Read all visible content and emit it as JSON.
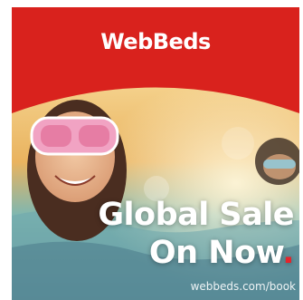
{
  "brand": {
    "logo_text": "WebBeds"
  },
  "headline": {
    "line1": "Global Sale",
    "line2": "On Now",
    "dot": "."
  },
  "footer": {
    "url": "webbeds.com/book"
  },
  "colors": {
    "brand_red": "#d9221d",
    "headline_text": "#ffffff",
    "accent_dot": "#e5242b"
  },
  "icons": {
    "hero_image": "child-in-pool-with-goggles"
  }
}
